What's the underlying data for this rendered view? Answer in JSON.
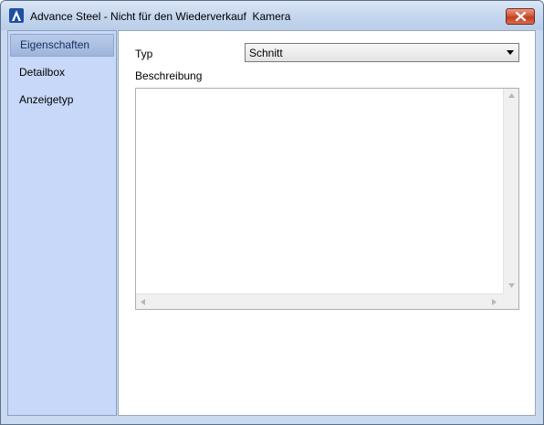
{
  "window": {
    "title": "Advance Steel - Nicht für den Wiederverkauf  Kamera"
  },
  "sidebar": {
    "items": [
      {
        "label": "Eigenschaften",
        "active": true
      },
      {
        "label": "Detailbox",
        "active": false
      },
      {
        "label": "Anzeigetyp",
        "active": false
      }
    ]
  },
  "form": {
    "typ_label": "Typ",
    "typ_value": "Schnitt",
    "beschreibung_label": "Beschreibung",
    "beschreibung_value": ""
  },
  "icons": {
    "app": "advance-steel-logo-icon",
    "close": "close-icon",
    "dropdown": "chevron-down-icon"
  },
  "colors": {
    "close_button": "#c94a2c",
    "sidebar_bg": "#c8d8f8",
    "titlebar_bg": "#c6d7ee"
  }
}
